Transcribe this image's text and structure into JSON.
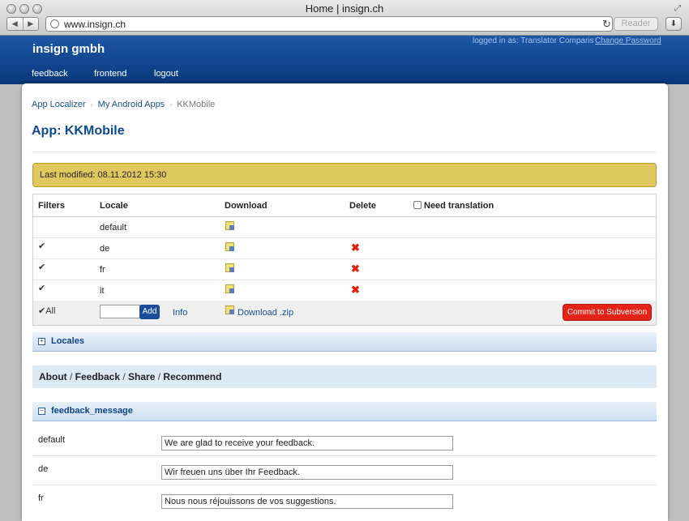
{
  "window": {
    "title": "Home | insign.ch",
    "url": "www.insign.ch",
    "reader_label": "Reader"
  },
  "header": {
    "brand": "insign gmbh",
    "login_info": "logged in as: Translator Comparis",
    "change_password": "Change Password",
    "nav": [
      "feedback",
      "frontend",
      "logout"
    ]
  },
  "breadcrumb": {
    "items": [
      "App Localizer",
      "My Android Apps"
    ],
    "current": "KKMobile"
  },
  "page_title": "App: KKMobile",
  "modified": "Last modified: 08.11.2012 15:30",
  "locales_table": {
    "headers": {
      "filters": "Filters",
      "locale": "Locale",
      "download": "Download",
      "delete": "Delete",
      "need_translation": "Need translation"
    },
    "rows": [
      {
        "locale": "default",
        "filter_checked": false,
        "deletable": false
      },
      {
        "locale": "de",
        "filter_checked": true,
        "deletable": true
      },
      {
        "locale": "fr",
        "filter_checked": true,
        "deletable": true
      },
      {
        "locale": "it",
        "filter_checked": true,
        "deletable": true
      }
    ],
    "footer": {
      "all_label": "All",
      "add_button": "Add",
      "info_link": "Info",
      "download_zip": "Download .zip",
      "commit_button": "Commit to Subversion"
    }
  },
  "panels": {
    "locales": "Locales",
    "feedback_message": "feedback_message"
  },
  "section": [
    "About",
    "Feedback",
    "Share",
    "Recommend"
  ],
  "messages": [
    {
      "locale": "default",
      "value": "We are glad to receive your feedback."
    },
    {
      "locale": "de",
      "value": "Wir freuen uns über Ihr Feedback."
    },
    {
      "locale": "fr",
      "value": "Nous nous réjouissons de vos suggestions."
    }
  ],
  "colors": {
    "header_blue": "#0c4a92",
    "commit_red": "#e62319",
    "modified_yellow": "#dfc95e"
  },
  "icons": {
    "download": "download-file-icon",
    "delete": "delete-x-icon",
    "reload": "reload-icon",
    "expand": "fullscreen-icon"
  }
}
